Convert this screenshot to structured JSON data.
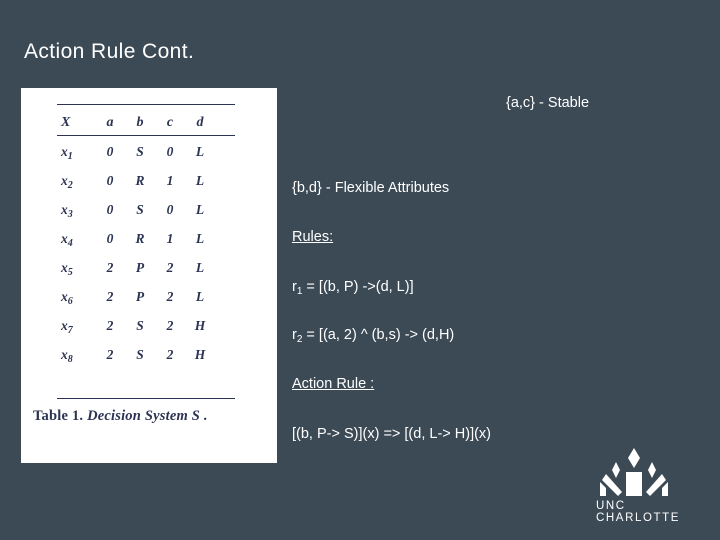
{
  "slide": {
    "title": "Action Rule Cont.",
    "background_color": "#3c4a56",
    "text_color": "#ffffff"
  },
  "table_image": {
    "columns": [
      "X",
      "a",
      "b",
      "c",
      "d"
    ],
    "rows": [
      {
        "id": "x",
        "sub": "1",
        "cells": [
          "0",
          "S",
          "0",
          "L"
        ]
      },
      {
        "id": "x",
        "sub": "2",
        "cells": [
          "0",
          "R",
          "1",
          "L"
        ]
      },
      {
        "id": "x",
        "sub": "3",
        "cells": [
          "0",
          "S",
          "0",
          "L"
        ]
      },
      {
        "id": "x",
        "sub": "4",
        "cells": [
          "0",
          "R",
          "1",
          "L"
        ]
      },
      {
        "id": "x",
        "sub": "5",
        "cells": [
          "2",
          "P",
          "2",
          "L"
        ]
      },
      {
        "id": "x",
        "sub": "6",
        "cells": [
          "2",
          "P",
          "2",
          "L"
        ]
      },
      {
        "id": "x",
        "sub": "7",
        "cells": [
          "2",
          "S",
          "2",
          "H"
        ]
      },
      {
        "id": "x",
        "sub": "8",
        "cells": [
          "2",
          "S",
          "2",
          "H"
        ]
      }
    ],
    "caption_label": "Table 1.",
    "caption_text": "Decision System S ."
  },
  "content": {
    "stable": "{a,c} - Stable",
    "flexible": "{b,d} - Flexible Attributes",
    "rules_heading": "Rules:",
    "rule1_name": "r",
    "rule1_sub": "1",
    "rule1_body": " = [(b, P) ->(d, L)]",
    "rule2_name": "r",
    "rule2_sub": "2",
    "rule2_body": " = [(a, 2) ^ (b,s) -> (d,H)",
    "action_rule_heading": "Action Rule :",
    "action_rule_body": "[(b, P-> S)](x) => [(d, L-> H)](x)"
  },
  "logo": {
    "text": "UNC CHARLOTTE",
    "color": "#ffffff"
  }
}
